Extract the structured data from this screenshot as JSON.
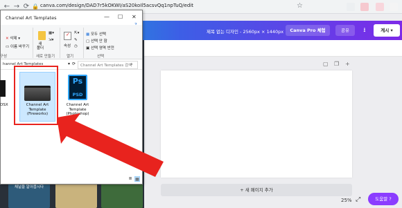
{
  "browser": {
    "url": "canva.com/design/DAD7r5kOKWI/aS20koIl5acsvQq1npTuQ/edit"
  },
  "canva": {
    "doc_title": "제목 없는 디자인 - 2560px × 1440px",
    "pro_button": "Canva Pro 체험",
    "share_button": "공유",
    "publish_button": "게시",
    "add_page": "+ 새 페이지 추가",
    "zoom": "25%",
    "help_button": "도움말 ?",
    "thumb_label": "채널을 알아봅시다"
  },
  "explorer": {
    "title": "Channel Art Templates",
    "ribbon": {
      "delete": "삭제",
      "rename": "이름 바꾸기",
      "new_folder": "새\n폴더",
      "properties": "속성",
      "select_all": "모두 선택",
      "select_none": "선택 안 함",
      "invert_selection": "선택 영역 반전",
      "group_organize": "구성",
      "group_new": "새로 만들기",
      "group_open": "열기",
      "group_select": "선택"
    },
    "address": "hannel Art Templates",
    "search_placeholder": "Channel Art Templates 검색",
    "files": [
      {
        "label": "OSX"
      },
      {
        "label": "Channel Art Template (Fireworks)"
      },
      {
        "label": "Channel Art Template (Photoshop)"
      }
    ],
    "psd_icon_text": "Ps",
    "psd_icon_sub": "PSD"
  },
  "colors": {
    "highlight": "#e8231e",
    "canva_gradient_start": "#00c4cc",
    "canva_gradient_end": "#7d2ae8",
    "help_purple": "#8b3dff"
  }
}
